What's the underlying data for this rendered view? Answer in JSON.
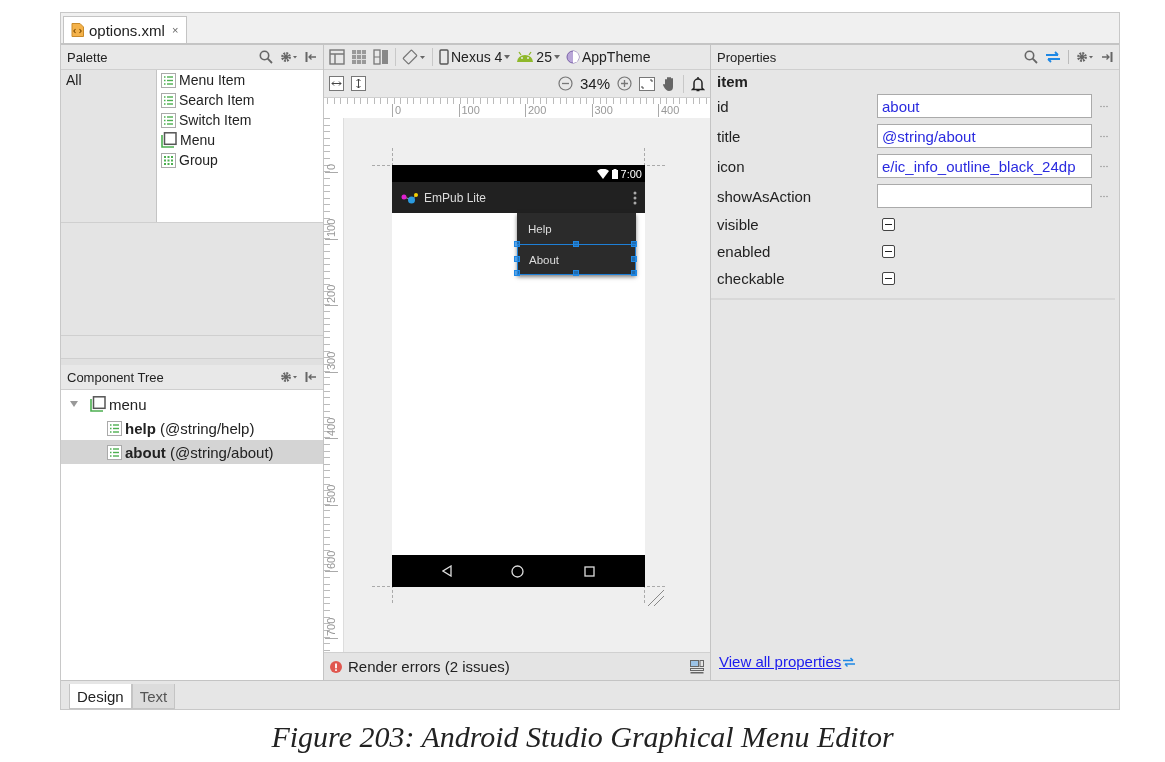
{
  "editor_tabs": [
    {
      "label": "options.xml",
      "close": "×",
      "selected": true
    }
  ],
  "palette": {
    "title": "Palette",
    "categories": [
      "All"
    ],
    "items": [
      {
        "label": "Menu Item",
        "kind": "item"
      },
      {
        "label": "Search Item",
        "kind": "item"
      },
      {
        "label": "Switch Item",
        "kind": "item"
      },
      {
        "label": "Menu",
        "kind": "menu"
      },
      {
        "label": "Group",
        "kind": "group"
      }
    ]
  },
  "component_tree": {
    "title": "Component Tree",
    "nodes": [
      {
        "name": "menu",
        "kind": "menu",
        "expanded": true,
        "selected": false,
        "children": [
          {
            "name": "help",
            "detail": "(@string/help)",
            "kind": "item",
            "selected": false
          },
          {
            "name": "about",
            "detail": "(@string/about)",
            "kind": "item",
            "selected": true
          }
        ]
      }
    ]
  },
  "design_toolbar": {
    "device": "Nexus 4",
    "api_level": "25",
    "theme": "AppTheme",
    "zoom": "34%"
  },
  "rulers": {
    "horizontal": [
      "0",
      "100",
      "200",
      "300",
      "400"
    ],
    "vertical": [
      "0",
      "100",
      "200",
      "300",
      "400",
      "500",
      "600",
      "700"
    ]
  },
  "preview": {
    "time": "7:00",
    "app_title": "EmPub Lite",
    "menu_items": [
      {
        "label": "Help",
        "selected": false
      },
      {
        "label": "About",
        "selected": true
      }
    ]
  },
  "status": {
    "message": "Render errors (2 issues)"
  },
  "properties": {
    "title": "Properties",
    "tag": "item",
    "fields": [
      {
        "name": "id",
        "kind": "text",
        "value": "about"
      },
      {
        "name": "title",
        "kind": "text",
        "value": "@string/about"
      },
      {
        "name": "icon",
        "kind": "text",
        "value": "e/ic_info_outline_black_24dp"
      },
      {
        "name": "showAsAction",
        "kind": "text"
      },
      {
        "name": "visible",
        "kind": "tristate",
        "indeterminate": true
      },
      {
        "name": "enabled",
        "kind": "tristate",
        "indeterminate": true
      },
      {
        "name": "checkable",
        "kind": "tristate",
        "indeterminate": true
      }
    ],
    "link": "View all properties"
  },
  "bottom_tabs": [
    {
      "label": "Design",
      "selected": true
    },
    {
      "label": "Text",
      "selected": false
    }
  ],
  "caption": "Figure 203: Android Studio Graphical Menu Editor"
}
